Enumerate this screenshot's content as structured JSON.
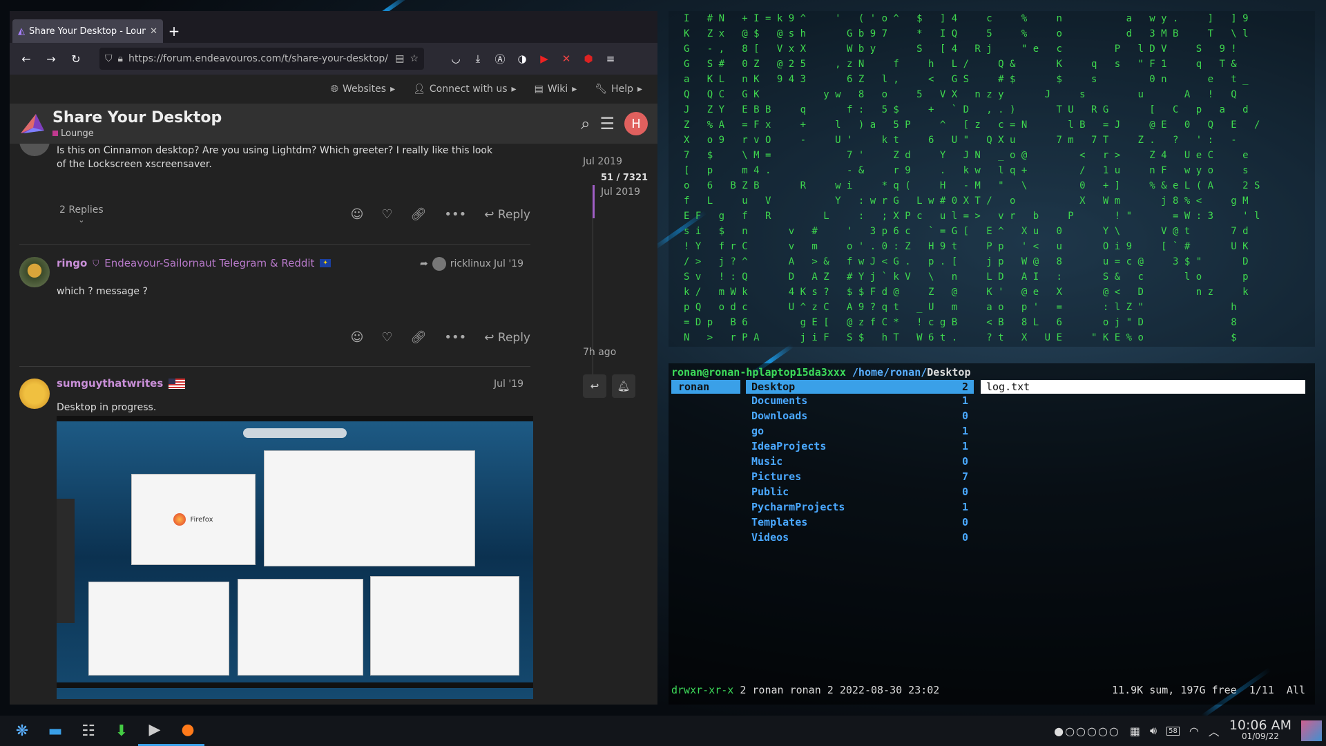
{
  "firefox": {
    "tab_title": "Share Your Desktop - Lounge",
    "new_tab": "+",
    "url": "https://forum.endeavouros.com/t/share-your-desktop/"
  },
  "forum": {
    "topnav": [
      "Websites",
      "Connect with us",
      "Wiki",
      "Help"
    ],
    "topic_title": "Share Your Desktop",
    "category": "Lounge",
    "avatar_letter": "H",
    "post1": {
      "text": "Is this on Cinnamon desktop? Are you using Lightdm? Which greeter? I really like this look of the Lockscreen xscreensaver.",
      "replies": "2 Replies",
      "reply_label": "Reply"
    },
    "post2": {
      "username": "ringo",
      "user_title": "Endeavour-Sailornaut Telegram & Reddit",
      "reply_to": "ricklinux",
      "date": "Jul '19",
      "text": "which ? message ?",
      "reply_label": "Reply"
    },
    "post3": {
      "username": "sumguythatwrites",
      "date": "Jul '19",
      "text": "Desktop in progress.",
      "screenshot_label": "Firefox"
    },
    "timeline": {
      "top_date": "Jul 2019",
      "position": "51 / 7321",
      "position_date": "Jul 2019",
      "bottom": "7h ago"
    }
  },
  "matrix": {
    "lines": [
      "I   # N   + I = k 9 ^     '   ( ' o ^   $   ] 4     c     %     n           a   w y .     ]   ] 9",
      "K   Z x   @ $   @ s h       G b 9 7     *   I Q     5     %     o           d   3 M B     T   \\ l",
      "G   - ,   8 [   V x X       W b y       S   [ 4   R j     \" e   c         P   l D V     S   9 !",
      "G   S #   0 Z   @ 2 5     , z N     f     h   L /     Q &       K     q   s   \" F 1     q   T &",
      "a   K L   n K   9 4 3       6 Z   l ,     <   G S     # $       $     s         0 n       e   t _",
      "Q   Q C   G K           y w   8   o     5   V X   n z y       J     s         u       A   !   Q",
      "J   Z Y   E B B     q       f :   5 $     +   ` D   , . )       T U   R G       [   C   p   a   d",
      "Z   % A   = F x     +     l   ) a   5 P     ^   [ z   c = N       l B   = J     @ E   0   Q   E   /",
      "X   o 9   r v O     -     U '     k t     6   U \"   Q X u       7 m   7 T     Z .   ?   ' :   -",
      "7   $     \\ M =             7 '     Z d     Y   J N   _ o @         <   r >     Z 4   U e C     e",
      "[   p     m 4 .             - &     r 9     .   k w   l q +         /   1 u     n F   w y o     s",
      "o   6   B Z B       R     w i     * q (     H   - M   \"   \\         0   + ]     % & e L ( A     2 S",
      "f   L     u   V           Y   : w r G   L w # 0 X T /   o           X   W m       j 8 % <     g M",
      "E F   g   f   R         L     :   ; X P c   u l = >   v r   b     P       ! \"       = W : 3     ' l",
      "s i   $   n       v   #     '   3 p 6 c   ` = G [   E ^   X u   0       Y \\       V @ t       7 d",
      "! Y   f r C       v   m     o ' . 0 : Z   H 9 t     P p   ' <   u       O i 9     [ ` #       U K",
      "/ >   j ? ^       A   > &   f w J < G .   p . [     j p   W @   8       u = c @     3 $ \"       D",
      "S v   ! : Q       D   A Z   # Y j ` k V   \\   n     L D   A I   :       S &   c       l o       p",
      "k /   m W k       4 K s ?   $ $ F d @     Z   @     K '   @ e   X       @ <   D         n z     k",
      "p Q   o d c       U ^ z C   A 9 ? q t   _ U   m     a o   p '   =       : l Z \"               h",
      "= D p   B 6         g E [   @ z f C *   ! c g B     < B   8 L   6       o j \" D               8",
      "N   >   r P A       j i F   S $   h T   W 6 t .     ? t   X   U E     \" K E % o               $"
    ]
  },
  "ranger": {
    "header_user": "ronan@ronan-hplaptop15da3xxx",
    "header_path": "/home/ronan/",
    "header_dir": "Desktop",
    "parent": "ronan",
    "entries": [
      {
        "name": "Desktop",
        "count": "2"
      },
      {
        "name": "Documents",
        "count": "1"
      },
      {
        "name": "Downloads",
        "count": "0"
      },
      {
        "name": "go",
        "count": "1"
      },
      {
        "name": "IdeaProjects",
        "count": "1"
      },
      {
        "name": "Music",
        "count": "0"
      },
      {
        "name": "Pictures",
        "count": "7"
      },
      {
        "name": "Public",
        "count": "0"
      },
      {
        "name": "PycharmProjects",
        "count": "1"
      },
      {
        "name": "Templates",
        "count": "0"
      },
      {
        "name": "Videos",
        "count": "0"
      }
    ],
    "preview": "log.txt",
    "status_perm": "drwxr-xr-x",
    "status_info": "2 ronan ronan 2 2022-08-30 23:02",
    "status_right": "11.9K sum, 197G free  1/11  All"
  },
  "taskbar": {
    "pager": "●○○○○○",
    "battery": "58",
    "time": "10:06 AM",
    "date": "01/09/22"
  }
}
